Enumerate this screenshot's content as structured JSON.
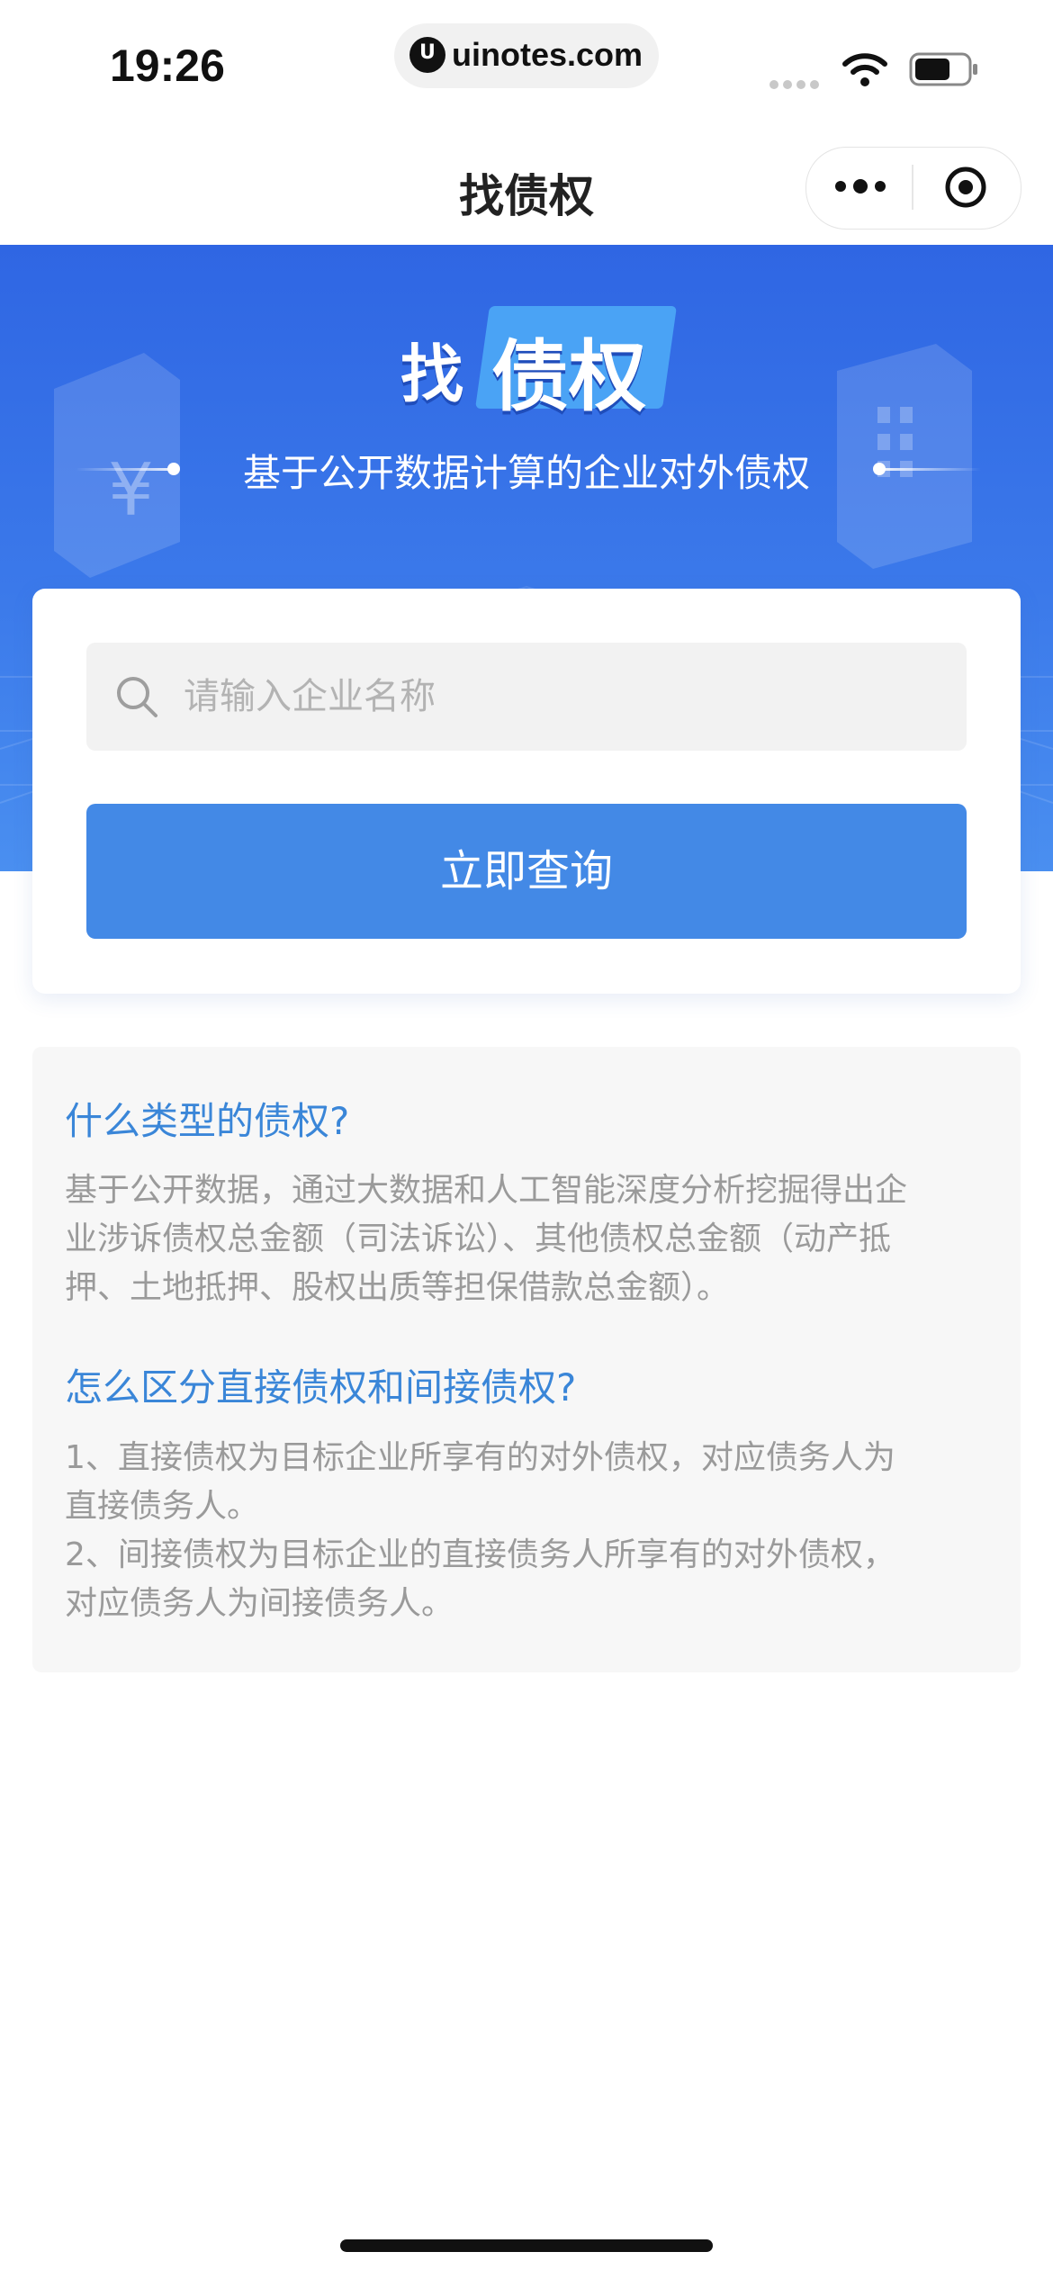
{
  "status_bar": {
    "time": "19:26",
    "url": "uinotes.com",
    "url_logo_letter": "U"
  },
  "nav": {
    "title": "找债权"
  },
  "banner": {
    "title_prefix": "找",
    "title_main": "债权",
    "subtitle": "基于公开数据计算的企业对外债权"
  },
  "search": {
    "placeholder": "请输入企业名称",
    "button_label": "立即查询"
  },
  "faq": [
    {
      "question": "什么类型的债权?",
      "answer_lines": [
        "基于公开数据，通过大数据和人工智能深度分析挖掘得出企",
        "业涉诉债权总金额（司法诉讼）、其他债权总金额（动产抵",
        "押、土地抵押、股权出质等担保借款总金额）。"
      ]
    },
    {
      "question": "怎么区分直接债权和间接债权?",
      "answer_lines": [
        "1、直接债权为目标企业所享有的对外债权，对应债务人为",
        "直接债务人。",
        "2、间接债权为目标企业的直接债务人所享有的对外债权，",
        "对应债务人为间接债务人。"
      ]
    }
  ],
  "colors": {
    "banner": "#3b79ea",
    "button": "#4389e6",
    "question": "#3a86d8",
    "answer": "#9a9a9a"
  }
}
